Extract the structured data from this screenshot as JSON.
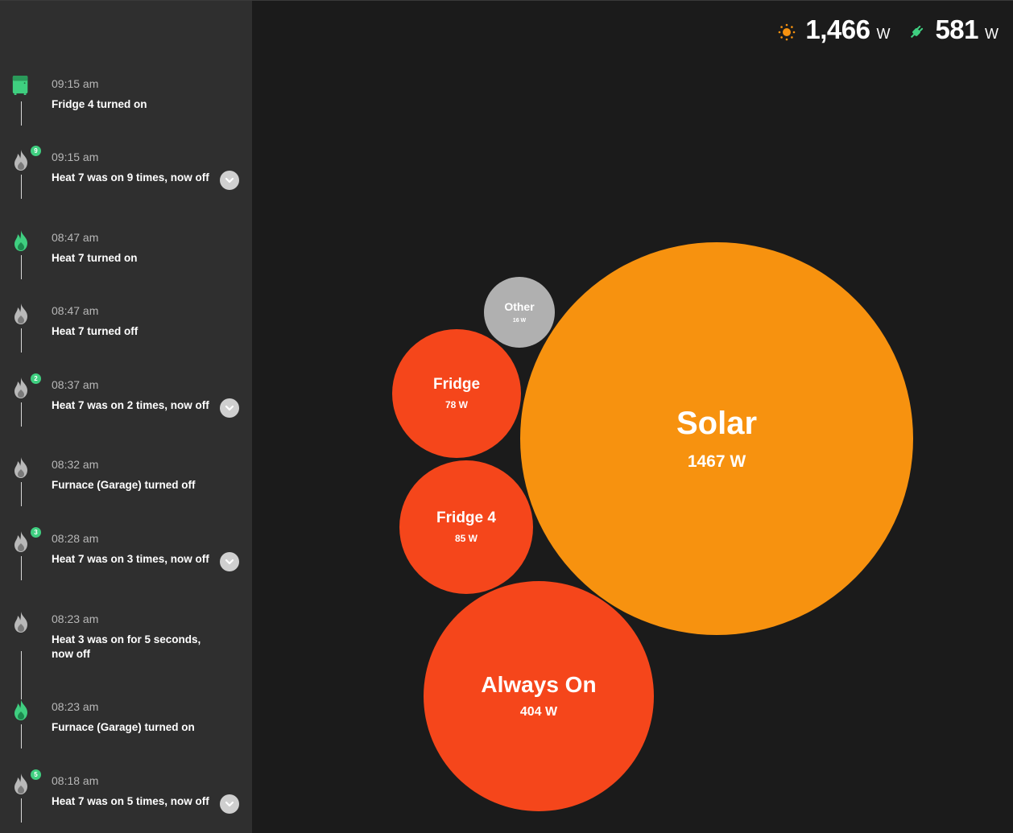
{
  "header": {
    "solar_value": "1,466",
    "solar_unit": "W",
    "solar_icon": "sun-icon",
    "usage_value": "581",
    "usage_unit": "W",
    "usage_icon": "plug-icon"
  },
  "colors": {
    "solar": "#f7920f",
    "device": "#f5461b",
    "other": "#b0b0b0",
    "accent_green": "#3fcf80",
    "icon_off": "#b9b9b9"
  },
  "timeline": [
    {
      "time": "09:15 am",
      "text": "Fridge 4 turned on",
      "icon": "fridge-icon",
      "state": "on",
      "badge": null,
      "expandable": false
    },
    {
      "time": "09:15 am",
      "text": "Heat 7 was on 9 times, now off",
      "icon": "flame-icon",
      "state": "off",
      "badge": "9",
      "expandable": true
    },
    {
      "time": "08:47 am",
      "text": "Heat 7 turned on",
      "icon": "flame-icon",
      "state": "on",
      "badge": null,
      "expandable": false
    },
    {
      "time": "08:47 am",
      "text": "Heat 7 turned off",
      "icon": "flame-icon",
      "state": "off",
      "badge": null,
      "expandable": false
    },
    {
      "time": "08:37 am",
      "text": "Heat 7 was on 2 times, now off",
      "icon": "flame-icon",
      "state": "off",
      "badge": "2",
      "expandable": true
    },
    {
      "time": "08:32 am",
      "text": "Furnace (Garage) turned off",
      "icon": "flame-icon",
      "state": "off",
      "badge": null,
      "expandable": false
    },
    {
      "time": "08:28 am",
      "text": "Heat 7 was on 3 times, now off",
      "icon": "flame-icon",
      "state": "off",
      "badge": "3",
      "expandable": true
    },
    {
      "time": "08:23 am",
      "text": "Heat 3 was on for 5 seconds, now off",
      "icon": "flame-icon",
      "state": "off",
      "badge": null,
      "expandable": false
    },
    {
      "time": "08:23 am",
      "text": "Furnace (Garage) turned on",
      "icon": "flame-icon",
      "state": "on",
      "badge": null,
      "expandable": false
    },
    {
      "time": "08:18 am",
      "text": "Heat 7 was on 5 times, now off",
      "icon": "flame-icon",
      "state": "off",
      "badge": "5",
      "expandable": true
    }
  ],
  "bubbles": [
    {
      "label": "Solar",
      "value": "1467 W",
      "kind": "solar"
    },
    {
      "label": "Always On",
      "value": "404 W",
      "kind": "device"
    },
    {
      "label": "Fridge 4",
      "value": "85 W",
      "kind": "device"
    },
    {
      "label": "Fridge",
      "value": "78 W",
      "kind": "device"
    },
    {
      "label": "Other",
      "value": "16 W",
      "kind": "other"
    }
  ]
}
